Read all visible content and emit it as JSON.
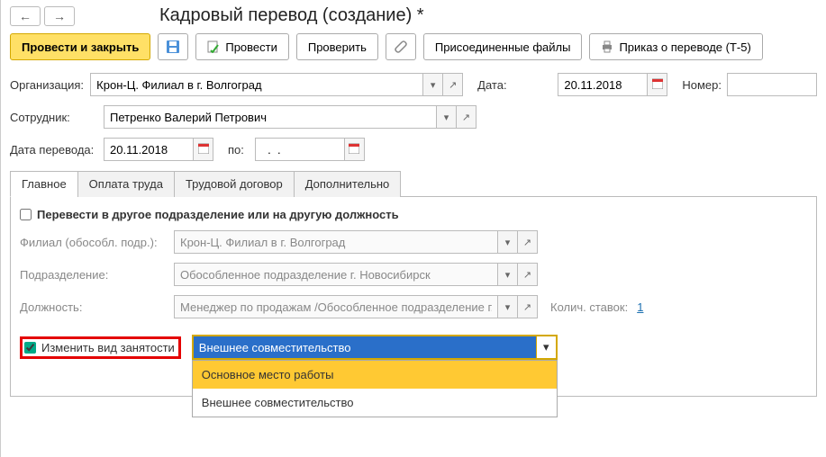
{
  "title": "Кадровый перевод (создание) *",
  "toolbar": {
    "postAndClose": "Провести и закрыть",
    "post": "Провести",
    "check": "Проверить",
    "attached": "Присоединенные файлы",
    "order": "Приказ о переводе (Т-5)"
  },
  "labels": {
    "org": "Организация:",
    "employee": "Сотрудник:",
    "transferDate": "Дата перевода:",
    "to": "по:",
    "date": "Дата:",
    "number": "Номер:",
    "ratesCount": "Колич. ставок:"
  },
  "values": {
    "org": "Крон-Ц. Филиал в г. Волгоград",
    "employee": "Петренко Валерий Петрович",
    "transferDate": "20.11.2018",
    "dateTo": "  .  .    ",
    "docDate": "20.11.2018",
    "docNumber": "",
    "rates": "1"
  },
  "tabs": [
    "Главное",
    "Оплата труда",
    "Трудовой договор",
    "Дополнительно"
  ],
  "mainTab": {
    "transferCheckbox": "Перевести в другое подразделение или на другую должность",
    "branchLabel": "Филиал (обособл. подр.):",
    "branchValue": "Крон-Ц. Филиал в г. Волгоград",
    "deptLabel": "Подразделение:",
    "deptValue": "Обособленное подразделение г. Новосибирск",
    "positionLabel": "Должность:",
    "positionValue": "Менеджер по продажам /Обособленное подразделение г. Н",
    "changeEmpType": "Изменить вид занятости",
    "empTypeValue": "Внешнее совместительство",
    "dropdown": [
      "Основное место работы",
      "Внешнее совместительство"
    ]
  }
}
